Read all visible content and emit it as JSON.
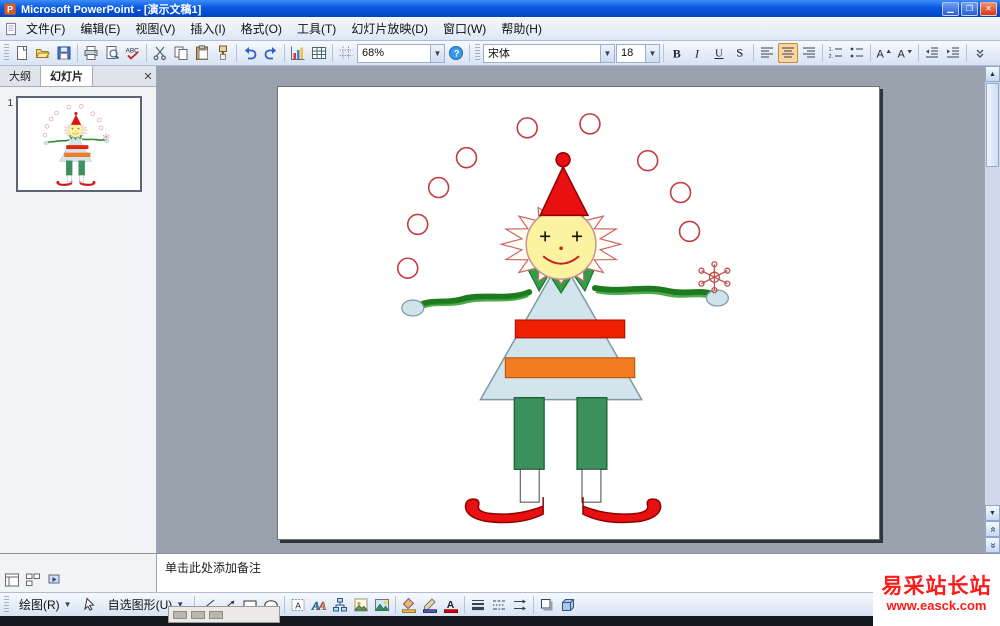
{
  "window": {
    "title": "Microsoft PowerPoint - [演示文稿1]"
  },
  "menu": {
    "items": [
      {
        "id": "file",
        "label": "文件(F)"
      },
      {
        "id": "edit",
        "label": "编辑(E)"
      },
      {
        "id": "view",
        "label": "视图(V)"
      },
      {
        "id": "insert",
        "label": "插入(I)"
      },
      {
        "id": "format",
        "label": "格式(O)"
      },
      {
        "id": "tools",
        "label": "工具(T)"
      },
      {
        "id": "slideshow",
        "label": "幻灯片放映(D)"
      },
      {
        "id": "window",
        "label": "窗口(W)"
      },
      {
        "id": "help",
        "label": "帮助(H)"
      }
    ]
  },
  "toolbars": {
    "zoom": "68%",
    "font": "宋体",
    "font_size": "18",
    "standard_icons": [
      "new",
      "open",
      "save",
      "sep",
      "print",
      "print-preview",
      "spelling",
      "sep",
      "cut",
      "copy",
      "paste",
      "format-painter",
      "sep",
      "undo",
      "redo",
      "sep",
      "insert-chart",
      "insert-table",
      "sep",
      "show-grid"
    ],
    "after_zoom_icons": [
      "help"
    ],
    "formatting_icons": [
      "bold",
      "italic",
      "underline",
      "shadow",
      "sep",
      "align-left",
      "align-center",
      "align-right",
      "sep",
      "numbering",
      "bullets",
      "sep",
      "increase-font",
      "decrease-font",
      "sep",
      "decrease-indent",
      "increase-indent",
      "sep",
      "toolbar-options"
    ],
    "active": [
      "align-center"
    ],
    "drawing_label": "绘图(R)",
    "autoshapes_label": "自选图形(U)",
    "select_icons": [
      "select"
    ],
    "drawing_icons": [
      "sep",
      "line",
      "arrow",
      "rectangle",
      "oval",
      "sep",
      "text-box",
      "word-art",
      "diagram",
      "clip-art",
      "picture",
      "sep",
      "fill-color",
      "line-color",
      "font-color",
      "sep",
      "line-style",
      "dash-style",
      "arrow-style",
      "sep",
      "shadow-style",
      "3d-style"
    ]
  },
  "left_panel": {
    "tabs": [
      "大纲",
      "幻灯片"
    ],
    "active_tab": "幻灯片",
    "slide_number": "1",
    "view_icons": [
      "view-normal",
      "view-sorter",
      "view-show"
    ]
  },
  "notes": {
    "placeholder": "单击此处添加备注"
  },
  "watermark": {
    "line1": "易采站长站",
    "line2": "www.easck.com",
    "color": "#ff1a1a"
  },
  "slide": {
    "clown_colors": {
      "hat": "#e81010",
      "face": "#fbf3a0",
      "collar": "#2f9e44",
      "body": "#d2e4ec",
      "stripe_red": "#ee2000",
      "stripe_orange": "#f47c20",
      "legs": "#3a915c",
      "shoes": "#e81010",
      "balls_stroke": "#c43c3c",
      "arms": "#1e7a1e",
      "hands": "#cfe3ea"
    }
  }
}
